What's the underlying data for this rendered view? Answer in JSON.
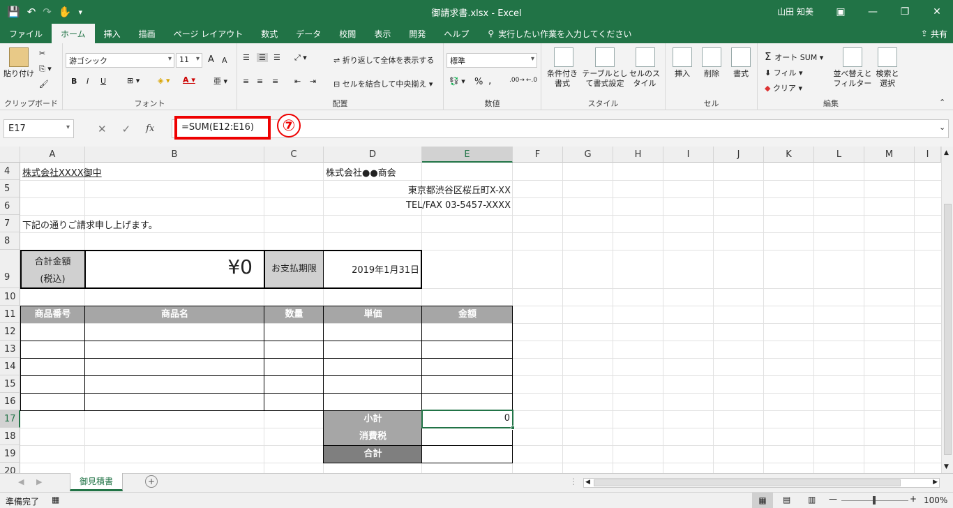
{
  "window": {
    "title": "御請求書.xlsx  -  Excel",
    "user": "山田 知美"
  },
  "tabs": [
    "ファイル",
    "ホーム",
    "挿入",
    "描画",
    "ページ レイアウト",
    "数式",
    "データ",
    "校閲",
    "表示",
    "開発",
    "ヘルプ"
  ],
  "active_tab": "ホーム",
  "tell_me": "実行したい作業を入力してください",
  "share": "共有",
  "ribbon": {
    "clipboard": {
      "paste": "貼り付け",
      "label": "クリップボード"
    },
    "font": {
      "name": "游ゴシック",
      "size": "11",
      "label": "フォント",
      "bold": "B",
      "italic": "I",
      "underline": "U",
      "grow": "A",
      "shrink": "A"
    },
    "alignment": {
      "wrap": "折り返して全体を表示する",
      "merge": "セルを結合して中央揃え",
      "label": "配置"
    },
    "number": {
      "format": "標準",
      "percent": "%",
      "comma": ",",
      "label": "数値"
    },
    "styles": {
      "conditional": "条件付き書式",
      "table": "テーブルとして書式設定",
      "cell": "セルのスタイル",
      "label": "スタイル"
    },
    "cells": {
      "insert": "挿入",
      "delete": "削除",
      "format": "書式",
      "label": "セル"
    },
    "editing": {
      "autosum": "オート SUM",
      "fill": "フィル",
      "clear": "クリア",
      "sort": "並べ替えとフィルター",
      "find": "検索と選択",
      "label": "編集"
    }
  },
  "formula_bar": {
    "name_box": "E17",
    "formula": "=SUM(E12:E16)",
    "step": "⑦",
    "fx": "fx"
  },
  "columns": [
    "A",
    "B",
    "C",
    "D",
    "E",
    "F",
    "G",
    "H",
    "I",
    "J",
    "K",
    "L",
    "M",
    "I"
  ],
  "rows": [
    "4",
    "5",
    "6",
    "7",
    "8",
    "9",
    "10",
    "11",
    "12",
    "13",
    "14",
    "15",
    "16",
    "17",
    "18",
    "19",
    "20"
  ],
  "cells": {
    "a4": "株式会社XXXX御中",
    "d4": "株式会社●●商会",
    "d5": "東京都渋谷区桜丘町X-XX",
    "d6": "TEL/FAX 03-5457-XXXX",
    "a7": "下記の通りご請求申し上げます。",
    "a9_line1": "合計金額",
    "a9_line2": "(税込)",
    "b9": "¥0",
    "c9": "お支払期限",
    "d9": "2019年1月31日",
    "h_product_no": "商品番号",
    "h_product_name": "商品名",
    "h_qty": "数量",
    "h_price": "単価",
    "h_amount": "金額",
    "d17": "小計",
    "e17": "0",
    "d18": "消費税",
    "d19": "合計"
  },
  "sheets": [
    "御見積書"
  ],
  "status": {
    "mode": "準備完了",
    "zoom": "100%"
  }
}
